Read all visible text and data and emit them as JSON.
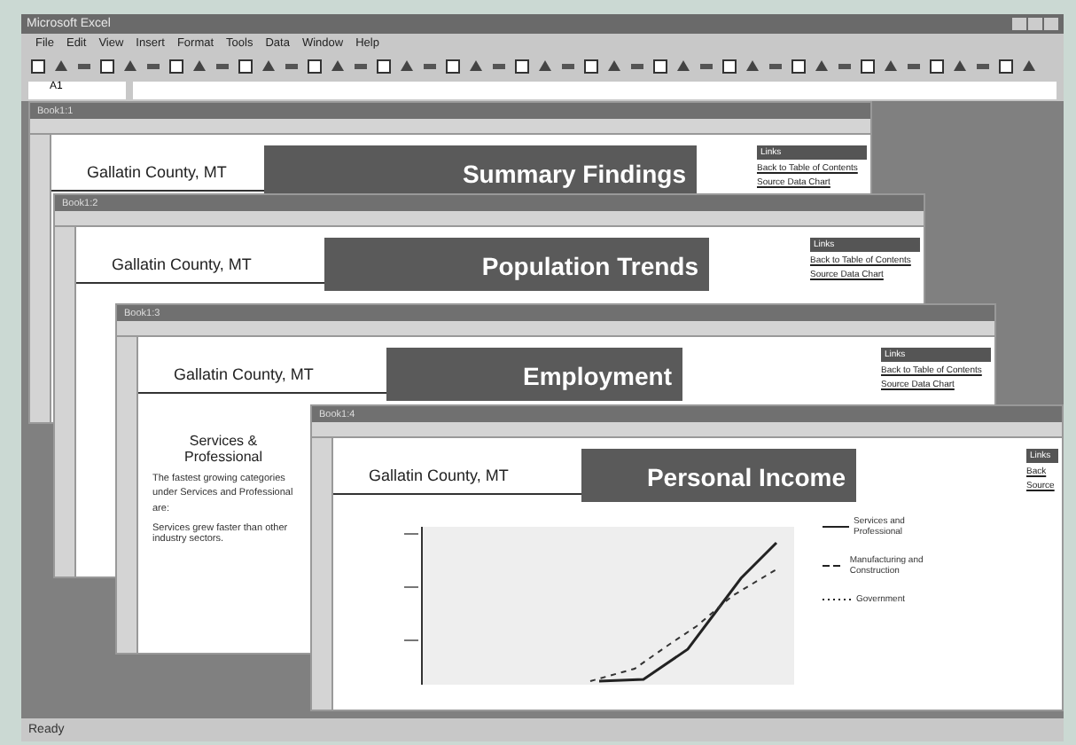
{
  "window": {
    "title": "Microsoft Excel"
  },
  "menu": [
    "File",
    "Edit",
    "View",
    "Insert",
    "Format",
    "Tools",
    "Data",
    "Window",
    "Help"
  ],
  "formula_bar": {
    "name_box": "A1"
  },
  "workbooks": [
    {
      "title": "Book1:1",
      "county": "Gallatin County, MT",
      "banner": "Summary Findings",
      "links": [
        "Links",
        "Back to Table of Contents",
        "Source Data Chart"
      ]
    },
    {
      "title": "Book1:2",
      "county": "Gallatin County, MT",
      "banner": "Population Trends",
      "links": [
        "Links",
        "Back to Table of Contents",
        "Source Data Chart"
      ]
    },
    {
      "title": "Book1:3",
      "county": "Gallatin County, MT",
      "banner": "Employment",
      "links": [
        "Links",
        "Back to Table of Contents",
        "Source Data Chart"
      ],
      "heading": "Services & Professional",
      "paragraph": "The fastest growing categories under Services and Professional are:",
      "bullet": "Services grew faster than other industry sectors."
    },
    {
      "title": "Book1:4",
      "county": "Gallatin County, MT",
      "banner": "Personal Income",
      "links": [
        "Links",
        "Back",
        "Source"
      ],
      "legend": [
        {
          "kind": "solid",
          "label": "Services and Professional"
        },
        {
          "kind": "dashed",
          "label": "Manufacturing and Construction"
        },
        {
          "kind": "dotted",
          "label": "Government"
        }
      ]
    }
  ],
  "status_bar": "Ready"
}
